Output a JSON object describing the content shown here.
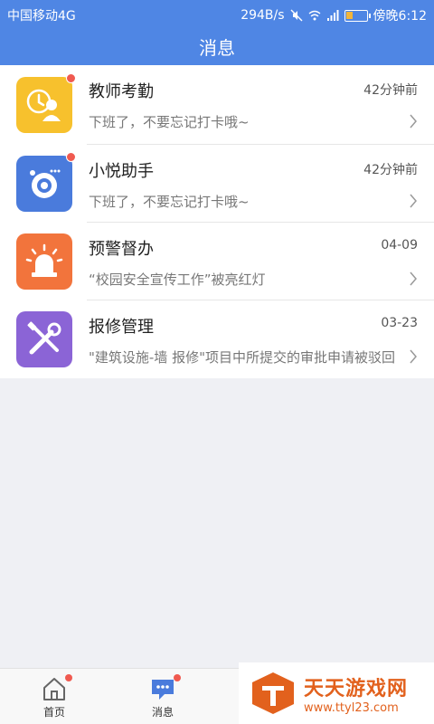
{
  "status_bar": {
    "carrier": "中国移动4G",
    "speed": "294B/s",
    "time": "傍晚6:12"
  },
  "header": {
    "title": "消息"
  },
  "messages": [
    {
      "title": "教师考勤",
      "time": "42分钟前",
      "preview": "下班了，不要忘记打卡哦~",
      "icon": "teacher-attendance-icon",
      "color": "#f7c12d",
      "unread": true
    },
    {
      "title": "小悦助手",
      "time": "42分钟前",
      "preview": "下班了，不要忘记打卡哦~",
      "icon": "assistant-camera-icon",
      "color": "#4a7bdc",
      "unread": true
    },
    {
      "title": "预警督办",
      "time": "04-09",
      "preview": "“校园安全宣传工作”被亮红灯",
      "icon": "alarm-light-icon",
      "color": "#f2743c",
      "unread": false
    },
    {
      "title": "报修管理",
      "time": "03-23",
      "preview": "\"建筑设施-墙 报修\"项目中所提交的审批申请被驳回",
      "icon": "repair-tools-icon",
      "color": "#8b64d6",
      "unread": false
    }
  ],
  "bottom_nav": {
    "tabs": [
      {
        "label": "首页",
        "icon": "home-icon"
      },
      {
        "label": "消息",
        "icon": "message-icon"
      }
    ]
  },
  "watermark": {
    "title": "天天游戏网",
    "url": "www.ttyl23.com"
  }
}
